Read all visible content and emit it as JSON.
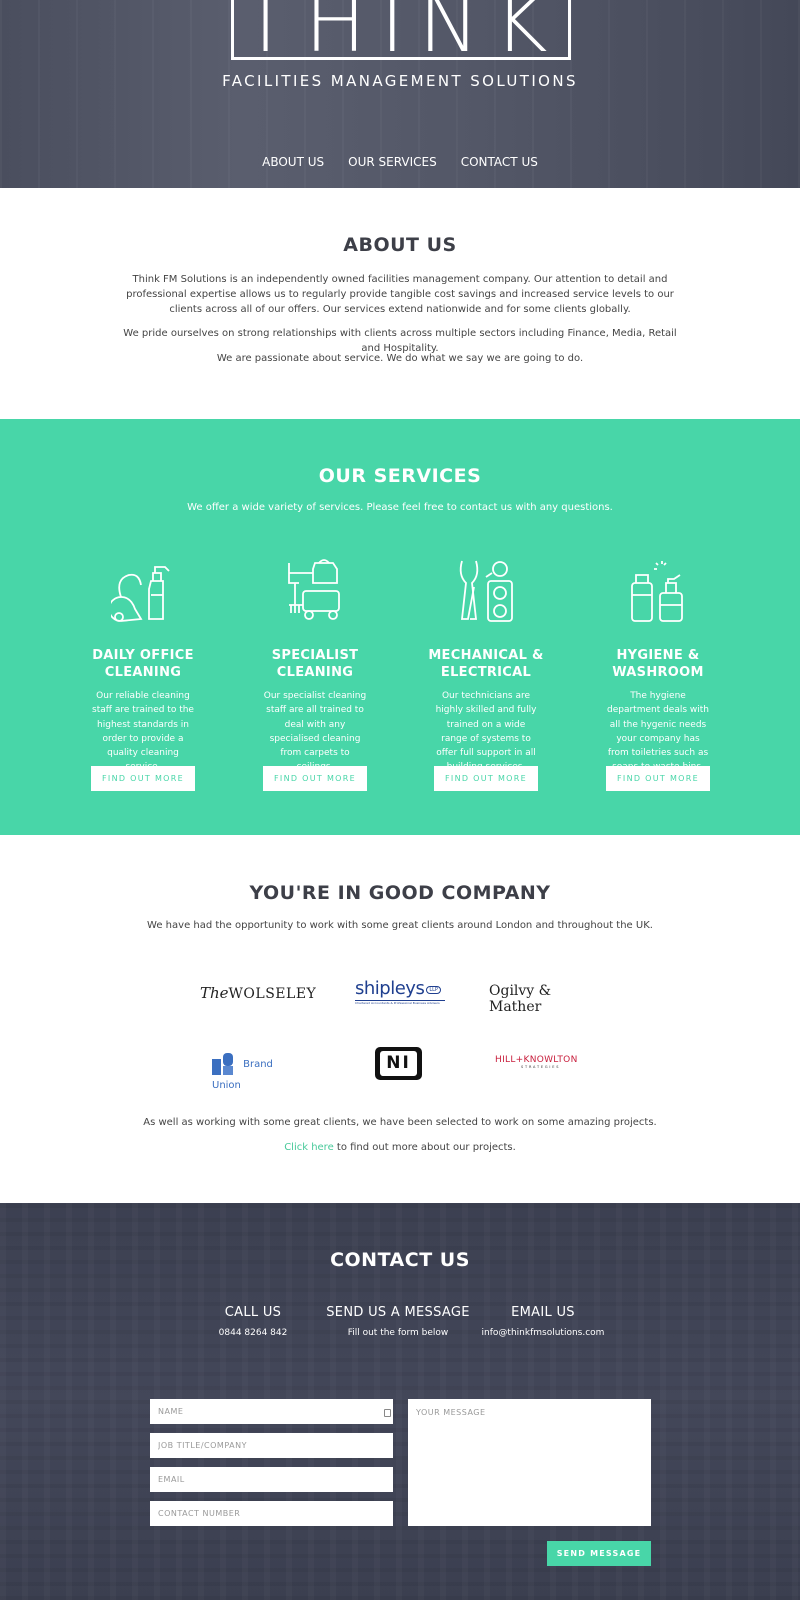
{
  "hero": {
    "logo_text": "THINK",
    "tagline": "FACILITIES MANAGEMENT SOLUTIONS",
    "nav": [
      "ABOUT US",
      "OUR SERVICES",
      "CONTACT US"
    ]
  },
  "about": {
    "title": "ABOUT US",
    "p1": "Think FM Solutions is an independently owned facilities management company. Our attention to detail and professional expertise allows us to regularly provide tangible cost savings and increased service levels to our clients across all of our offers. Our services extend nationwide and for some clients globally.",
    "p2": "We pride ourselves on strong relationships with clients across multiple sectors including Finance, Media, Retail and Hospitality.",
    "p3": "We are passionate about service. We do what we say we are going to do."
  },
  "services": {
    "title": "OUR SERVICES",
    "intro": "We offer a wide variety of services. Please feel free to contact us with any questions.",
    "items": [
      {
        "title_line1": "DAILY OFFICE",
        "title_line2": "CLEANING",
        "desc": "Our reliable cleaning staff are trained to the highest standards in order to provide a quality cleaning service.",
        "button": "FIND OUT MORE",
        "icon": "vacuum-spray-icon"
      },
      {
        "title_line1": "SPECIALIST",
        "title_line2": "CLEANING",
        "desc": "Our specialist cleaning staff are all trained to deal with any specialised cleaning from carpets to ceilings.",
        "button": "FIND OUT MORE",
        "icon": "cleaning-cart-icon"
      },
      {
        "title_line1": "MECHANICAL &",
        "title_line2": "ELECTRICAL",
        "desc": "Our technicians are highly skilled and fully trained on a wide range of systems to offer full support in all building services.",
        "button": "FIND OUT MORE",
        "icon": "pliers-socket-icon"
      },
      {
        "title_line1": "HYGIENE &",
        "title_line2": "WASHROOM",
        "desc": "The hygiene department deals with all the hygenic needs your company has from toiletries such as soaps to waste bins.",
        "button": "FIND OUT MORE",
        "icon": "soap-bottles-icon"
      }
    ]
  },
  "clients": {
    "title": "YOU'RE IN GOOD COMPANY",
    "intro": "We have had the opportunity to work with some great clients around London and throughout the UK.",
    "logos": {
      "wolseley_the": "The",
      "wolseley": "WOLSELEY",
      "shipleys": "shipleys",
      "shipleys_llp": "LLP",
      "shipleys_sub": "Chartered Accountants & Professional Business Advisers",
      "ogilvy": "Ogilvy & Mather",
      "brand_union": "Brand Union",
      "ni": "NI",
      "hill_knowlton": "HILL+KNOWLTON",
      "hill_knowlton_sub": "STRATEGIES"
    },
    "t1": "As well as working with some great clients, we have been selected to work on some amazing projects.",
    "link": "Click here",
    "t2_rest": " to find out more about our projects."
  },
  "contact": {
    "title": "CONTACT US",
    "columns": [
      {
        "heading": "CALL US",
        "value": "0844 8264 842"
      },
      {
        "heading": "SEND US A MESSAGE",
        "value": "Fill out the form below"
      },
      {
        "heading": "EMAIL US",
        "value": "info@thinkfmsolutions.com"
      }
    ],
    "placeholders": {
      "name": "NAME",
      "job": "JOB TITLE/COMPANY",
      "email": "EMAIL",
      "phone": "CONTACT NUMBER",
      "message": "YOUR MESSAGE"
    },
    "send": "SEND MESSAGE"
  }
}
